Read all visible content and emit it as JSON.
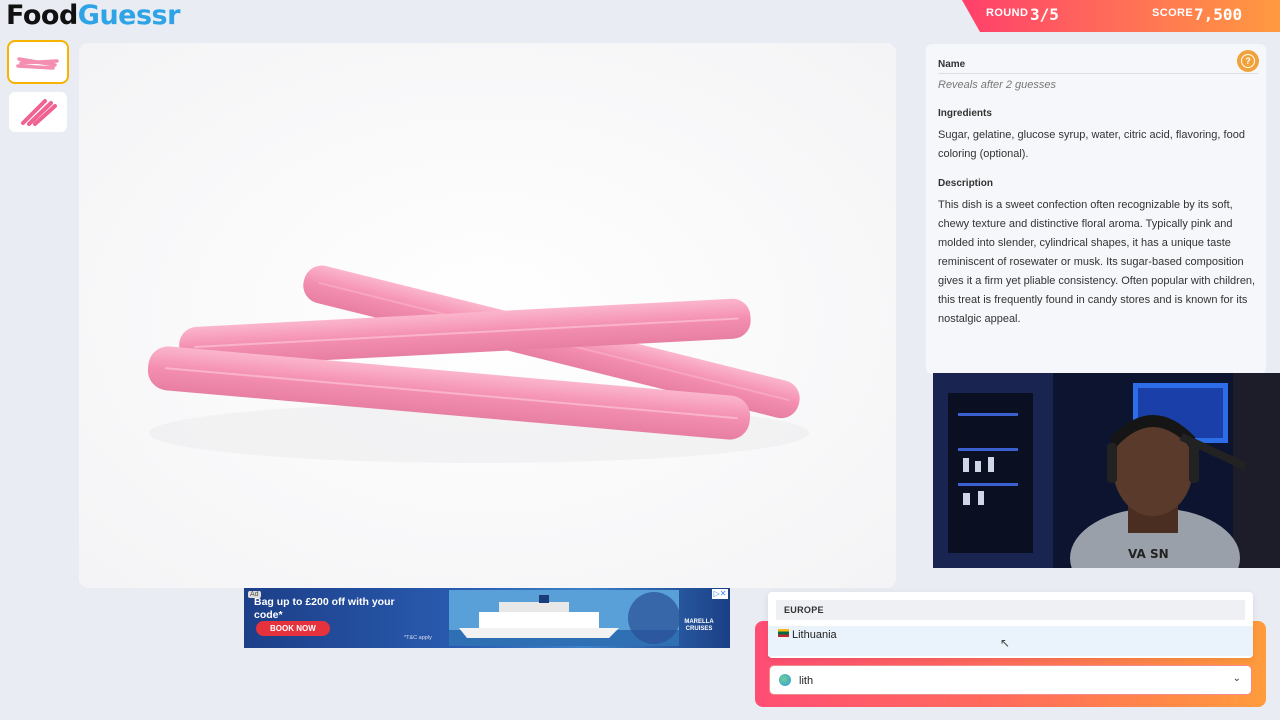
{
  "logo": {
    "part1": "Food",
    "part2": "Guessr"
  },
  "status": {
    "round_label": "ROUND",
    "round_value": "3/5",
    "score_label": "SCORE",
    "score_value": "7,500"
  },
  "thumbnails": [
    {
      "name": "photo-1"
    },
    {
      "name": "photo-2"
    }
  ],
  "info": {
    "name_heading": "Name",
    "name_value": "Reveals after 2 guesses",
    "ingredients_heading": "Ingredients",
    "ingredients_text": "Sugar, gelatine, glucose syrup, water, citric acid, flavoring, food coloring (optional).",
    "description_heading": "Description",
    "description_text": "This dish is a sweet confection often recognizable by its soft, chewy texture and distinctive floral aroma. Typically pink and molded into slender, cylindrical shapes, it has a unique taste reminiscent of rosewater or musk. Its sugar-based composition gives it a firm yet pliable consistency. Often popular with children, this treat is frequently found in candy stores and is known for its nostalgic appeal.",
    "help_icon": "question-icon"
  },
  "ad": {
    "tag": "Ad",
    "headline": "Bag up to £200 off with your code*",
    "button": "BOOK NOW",
    "terms": "*T&C apply",
    "brand": "MARELLA CRUISES"
  },
  "guess": {
    "dropdown_group": "EUROPE",
    "dropdown_option": "Lithuania",
    "input_value": "lith",
    "chevron_icon": "chevron-down-icon"
  },
  "colors": {
    "accent_orange": "#f2a23a",
    "brand_blue": "#2ea3e6",
    "banner_start": "#ff3f6b",
    "banner_end": "#ff9a3f"
  }
}
